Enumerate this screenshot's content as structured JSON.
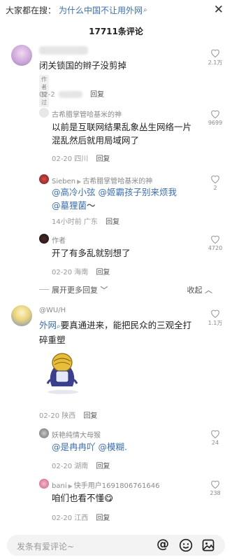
{
  "search_bar": {
    "prefix": "大家都在搜：",
    "query": "为什么中国不让用外网",
    "search_glyph": "⌕",
    "close_glyph": "✕"
  },
  "comments_header": {
    "count": "17711条评论"
  },
  "comments": [
    {
      "id": "c1",
      "user": "",
      "text": "闭关锁国的辫子没剪掉",
      "tag": "作者赞过",
      "time": "02-2",
      "reply": "回复",
      "likes": "2.1万"
    },
    {
      "id": "r1",
      "user": "古希腊掌管哈基米的神",
      "text": "以前是互联网结果乱象丛生网络一片混乱然后就用局域网了",
      "time": "02-20",
      "location": "四川",
      "reply": "回复",
      "likes": "9699"
    },
    {
      "id": "r2",
      "user": "Sieben",
      "reply_to": "古希腊掌管哈基米的神",
      "mention1": "@高冷小弦",
      "mention2": "@姬霸孩子别来烦我",
      "mention3": "@墓狸菌",
      "text_mid": " ",
      "text_end": "～",
      "time": "14小时前",
      "location": "广东",
      "reply": "回复",
      "likes": "2"
    },
    {
      "id": "r3",
      "user": "作者",
      "text": "开了有多乱就别想了",
      "time": "02-20",
      "location": "海南",
      "reply": "回复",
      "likes": "4720"
    },
    {
      "id": "c2",
      "user": "@WU/H",
      "mention": "外网",
      "search_glyph": "⌕",
      "text": "要真通进来，能把民众的三观全打碎重塑",
      "time": "02-20",
      "location": "陕西",
      "reply": "回复",
      "likes": "1.1万"
    },
    {
      "id": "r4",
      "user": "妖艳纯情大母猴",
      "mention1": "@是冉冉吖",
      "mention2": "@模糊.",
      "time": "02-20",
      "location": "湖南",
      "reply": "回复",
      "likes": "24"
    },
    {
      "id": "r5",
      "user": "bani",
      "reply_to": "快手用户1691806761646",
      "text": "咱们也看不懂",
      "emoji": "😋",
      "time": "02-20",
      "location": "江西",
      "reply": "回复",
      "likes": "238"
    }
  ],
  "expand_row": {
    "expand": "展开更多回复 ﹀",
    "collapse": "收起 ︿"
  },
  "input": {
    "placeholder": "发条有爱评论~"
  },
  "icons": {
    "at": "@",
    "emoji": "smile-icon",
    "image": "image-icon"
  },
  "colors": {
    "link": "#3b6fb6",
    "meta": "#999999"
  }
}
